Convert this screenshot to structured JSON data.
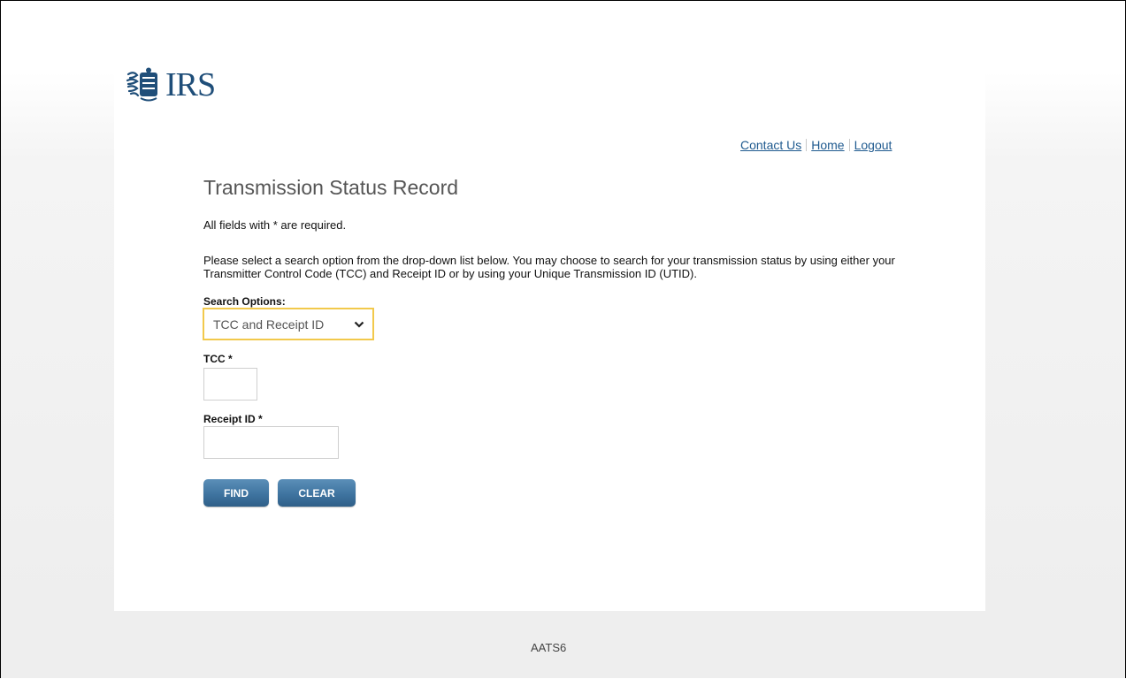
{
  "brand": {
    "logo_text": "IRS",
    "icon": "irs-eagle-icon",
    "color": "#1f4e79"
  },
  "header": {
    "links": [
      {
        "label": "Contact Us"
      },
      {
        "label": "Home"
      },
      {
        "label": "Logout"
      }
    ]
  },
  "page": {
    "title": "Transmission Status Record",
    "required_note": "All fields with * are required.",
    "description": "Please select a search option from the drop-down list below. You may choose to search for your transmission status by using either your Transmitter Control Code (TCC) and Receipt ID or by using your Unique Transmission ID (UTID)."
  },
  "form": {
    "search_options_label": "Search Options:",
    "search_options_value": "TCC and Receipt ID",
    "dropdown_icon": "chevron-down-icon",
    "tcc_label": "TCC *",
    "tcc_value": "",
    "receipt_label": "Receipt ID *",
    "receipt_value": "",
    "find_label": "FIND",
    "clear_label": "CLEAR"
  },
  "footer": {
    "code": "AATS6"
  },
  "colors": {
    "accent_border": "#f2c94c",
    "button": "#3f74a0",
    "link": "#1f5a8f"
  }
}
